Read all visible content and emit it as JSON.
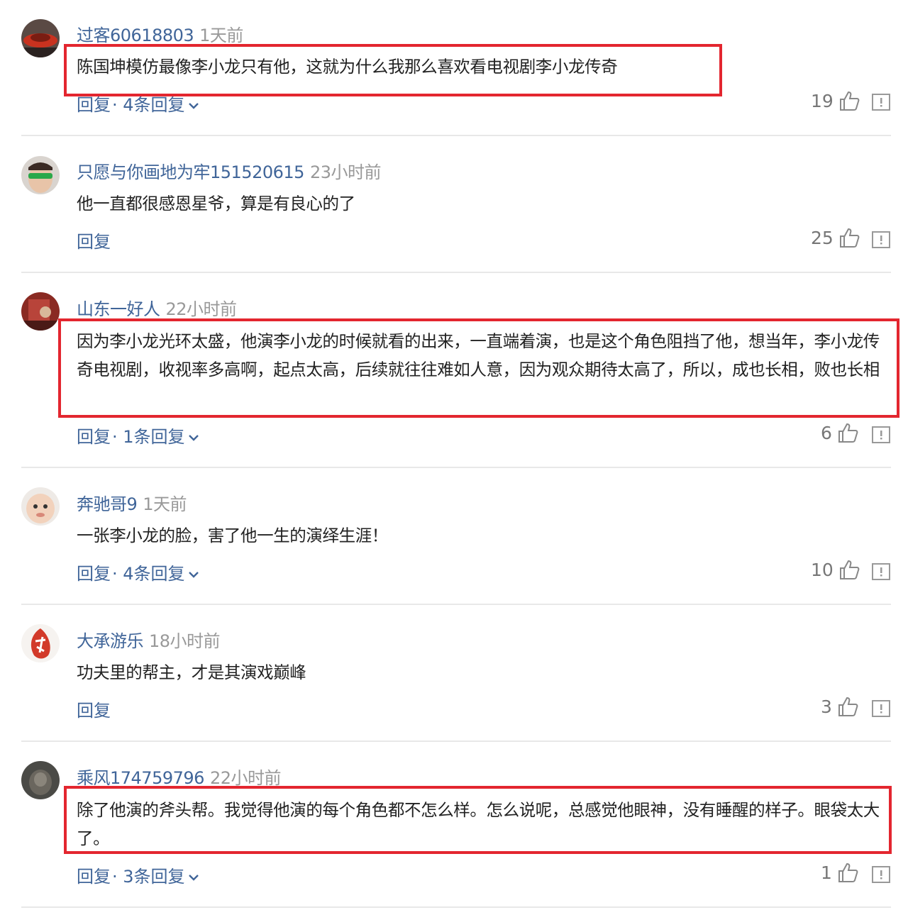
{
  "comments": [
    {
      "user": "过客60618803",
      "time": "1天前",
      "content": "陈国坤模仿最像李小龙只有他，这就为什么我那么喜欢看电视剧李小龙传奇",
      "reply_label": "回复",
      "more_replies": "· 4条回复",
      "likes": "19"
    },
    {
      "user": "只愿与你画地为牢151520615",
      "time": "23小时前",
      "content": "他一直都很感恩星爷，算是有良心的了",
      "reply_label": "回复",
      "more_replies": "",
      "likes": "25"
    },
    {
      "user": "山东一好人",
      "time": "22小时前",
      "content": "因为李小龙光环太盛，他演李小龙的时候就看的出来，一直端着演，也是这个角色阻挡了他，想当年，李小龙传奇电视剧，收视率多高啊，起点太高，后续就往往难如人意，因为观众期待太高了，所以，成也长相，败也长相",
      "reply_label": "回复",
      "more_replies": "· 1条回复",
      "likes": "6"
    },
    {
      "user": "奔驰哥9",
      "time": "1天前",
      "content": "一张李小龙的脸，害了他一生的演绎生涯！",
      "reply_label": "回复",
      "more_replies": "· 4条回复",
      "likes": "10"
    },
    {
      "user": "大承游乐",
      "time": "18小时前",
      "content": "功夫里的帮主，才是其演戏巅峰",
      "reply_label": "回复",
      "more_replies": "",
      "likes": "3"
    },
    {
      "user": "乘风174759796",
      "time": "22小时前",
      "content": "除了他演的斧头帮。我觉得他演的每个角色都不怎么样。怎么说呢，总感觉他眼神，没有睡醒的样子。眼袋太大了。",
      "reply_label": "回复",
      "more_replies": "· 3条回复",
      "likes": "1"
    }
  ],
  "colors": {
    "username": "#406599",
    "highlight_box": "#e3262f",
    "time": "#999999"
  },
  "icons": [
    "thumbs-up-icon",
    "report-icon",
    "chevron-down-icon"
  ]
}
